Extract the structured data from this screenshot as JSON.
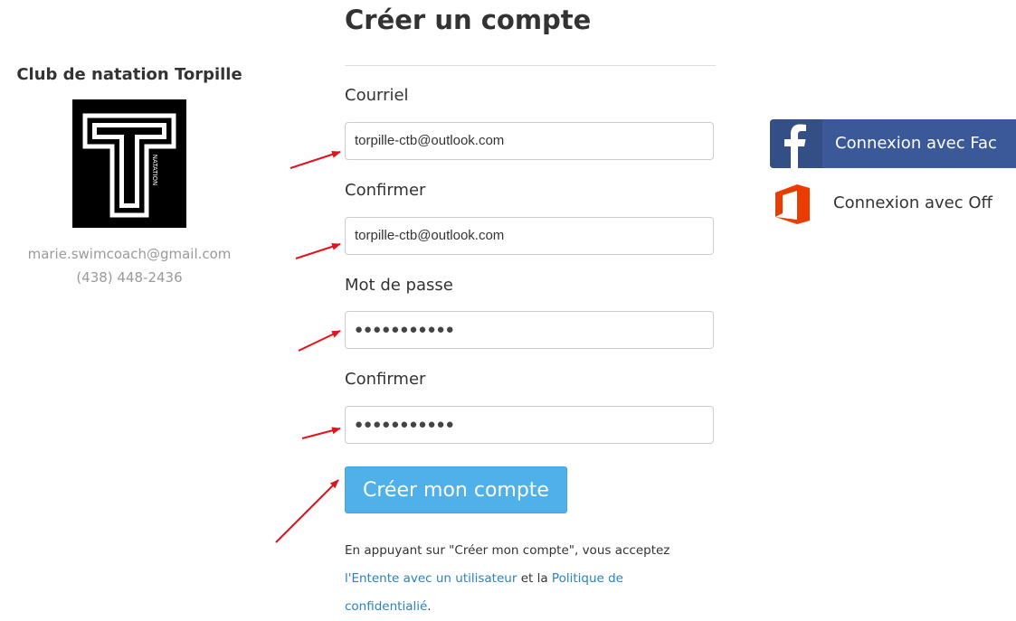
{
  "club": {
    "name": "Club de natation Torpille",
    "logo_letter": "T",
    "logo_side_text": "NATATION",
    "email": "marie.swimcoach@gmail.com",
    "phone": "(438) 448-2436"
  },
  "form": {
    "title": "Créer un compte",
    "email_label": "Courriel",
    "email_value": "torpille-ctb@outlook.com",
    "email_confirm_label": "Confirmer",
    "email_confirm_value": "torpille-ctb@outlook.com",
    "password_label": "Mot de passe",
    "password_value": "●●●●●●●●●●●",
    "password_confirm_label": "Confirmer",
    "password_confirm_value": "●●●●●●●●●●●",
    "submit_label": "Créer mon compte"
  },
  "legal": {
    "text_1": "En appuyant sur \"Créer mon compte\", vous acceptez",
    "link_terms": "l'Entente avec un utilisateur",
    "text_2": " et la ",
    "link_privacy_1": "Politique de",
    "link_privacy_2": "confidentialié",
    "text_end": "."
  },
  "social": {
    "facebook_label": "Connexion avec Fac",
    "office_label": "Connexion avec Off",
    "facebook_icon": "facebook-icon",
    "office_icon": "office-icon"
  },
  "colors": {
    "facebook": "#3b5998",
    "office": "#eb3c00",
    "submit_button": "#4fb0ea",
    "link": "#2a82c2",
    "annotation_arrow": "#e0141e"
  }
}
